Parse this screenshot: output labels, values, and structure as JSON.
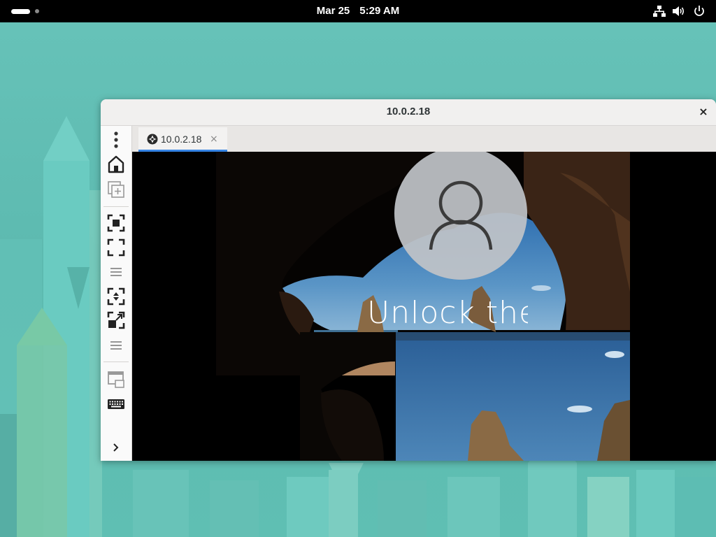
{
  "topbar": {
    "date": "Mar 25",
    "time": "5:29 AM",
    "icons": [
      "workspace-indicator",
      "network-icon",
      "volume-icon",
      "power-icon"
    ]
  },
  "window": {
    "title": "10.0.2.18",
    "close_label": "×"
  },
  "tabs": [
    {
      "label": "10.0.2.18",
      "close_label": "×",
      "icon": "remote-desktop-icon",
      "active": true
    }
  ],
  "sidebar": {
    "items": [
      "menu-icon",
      "home-icon",
      "new-connection-icon",
      "fit-window-icon",
      "fullscreen-icon",
      "separator-handle",
      "scale-icon",
      "resize-remote-icon",
      "separator-handle",
      "multi-monitor-icon",
      "keyboard-icon",
      "expand-sidebar-icon"
    ]
  },
  "remote": {
    "lock_text": "Unlock the F"
  },
  "colors": {
    "accent": "#3584e4",
    "wallpaper": "#5fbcb2",
    "topbar": "#000000"
  }
}
